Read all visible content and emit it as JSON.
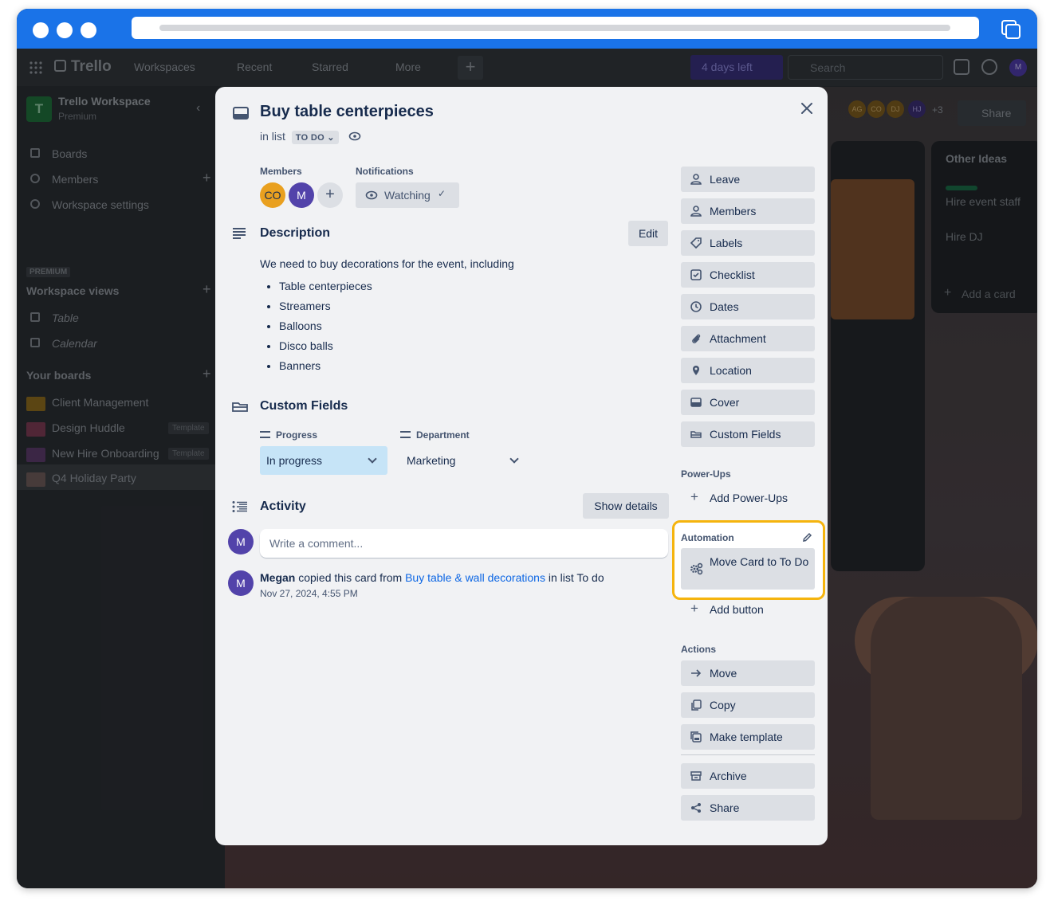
{
  "app": {
    "logo": "Trello",
    "nav": [
      "Workspaces",
      "Recent",
      "Starred",
      "More"
    ],
    "trial_label": "4 days left",
    "search_placeholder": "Search",
    "user_initial": "M"
  },
  "sidebar": {
    "workspace_initial": "T",
    "workspace_name": "Trello Workspace",
    "workspace_plan": "Premium",
    "items": [
      {
        "label": "Boards"
      },
      {
        "label": "Members"
      },
      {
        "label": "Workspace settings"
      }
    ],
    "premium_tag": "PREMIUM",
    "views_heading": "Workspace views",
    "views": [
      {
        "label": "Table"
      },
      {
        "label": "Calendar"
      }
    ],
    "boards_heading": "Your boards",
    "boards": [
      {
        "label": "Client Management",
        "tag": ""
      },
      {
        "label": "Design Huddle",
        "tag": "Template"
      },
      {
        "label": "New Hire Onboarding",
        "tag": "Template"
      },
      {
        "label": "Q4 Holiday Party",
        "tag": ""
      }
    ]
  },
  "board": {
    "share_label": "Share",
    "extra_members": "+3",
    "header_avatars": [
      "AG",
      "CO",
      "DJ",
      "HJ"
    ],
    "other_list_title": "Other Ideas",
    "other_cards": [
      "Hire event staff",
      "Hire DJ"
    ],
    "add_card_label": "Add a card"
  },
  "card": {
    "title": "Buy table centerpieces",
    "in_list_prefix": "in list",
    "list_name": "TO DO",
    "members_label": "Members",
    "notifications_label": "Notifications",
    "members": [
      {
        "initials": "CO",
        "bg": "#e9a01f"
      },
      {
        "initials": "M",
        "bg": "#5243aa"
      }
    ],
    "watching_label": "Watching",
    "description_title": "Description",
    "edit_label": "Edit",
    "description_intro": "We need to buy decorations for the event, including",
    "description_items": [
      "Table centerpieces",
      "Streamers",
      "Balloons",
      "Disco balls",
      "Banners"
    ],
    "custom_fields_title": "Custom Fields",
    "fields": [
      {
        "label": "Progress",
        "value": "In progress",
        "bg": "#c6e4f7"
      },
      {
        "label": "Department",
        "value": "Marketing",
        "bg": "transparent"
      }
    ],
    "activity_title": "Activity",
    "show_details_label": "Show details",
    "comment_placeholder": "Write a comment...",
    "activity": {
      "user": "Megan",
      "text_before": "copied this card from",
      "link": "Buy table & wall decorations",
      "text_after": "in list To do",
      "time": "Nov 27, 2024, 4:55 PM"
    },
    "avatar_initial": "M"
  },
  "actions_panel": {
    "add_to_card": [
      "Leave",
      "Members",
      "Labels",
      "Checklist",
      "Dates",
      "Attachment",
      "Location",
      "Cover",
      "Custom Fields"
    ],
    "powerups_heading": "Power-Ups",
    "add_powerups_label": "Add Power-Ups",
    "automation_heading": "Automation",
    "automation_button": "Move Card to To Do",
    "add_button_label": "Add button",
    "actions_heading": "Actions",
    "actions": [
      "Move",
      "Copy",
      "Make template"
    ],
    "bottom_actions": [
      "Archive",
      "Share"
    ]
  },
  "colors": {
    "highlight": "#f5b40e",
    "accent_blue": "#1a73e8",
    "link": "#0c66e4"
  }
}
